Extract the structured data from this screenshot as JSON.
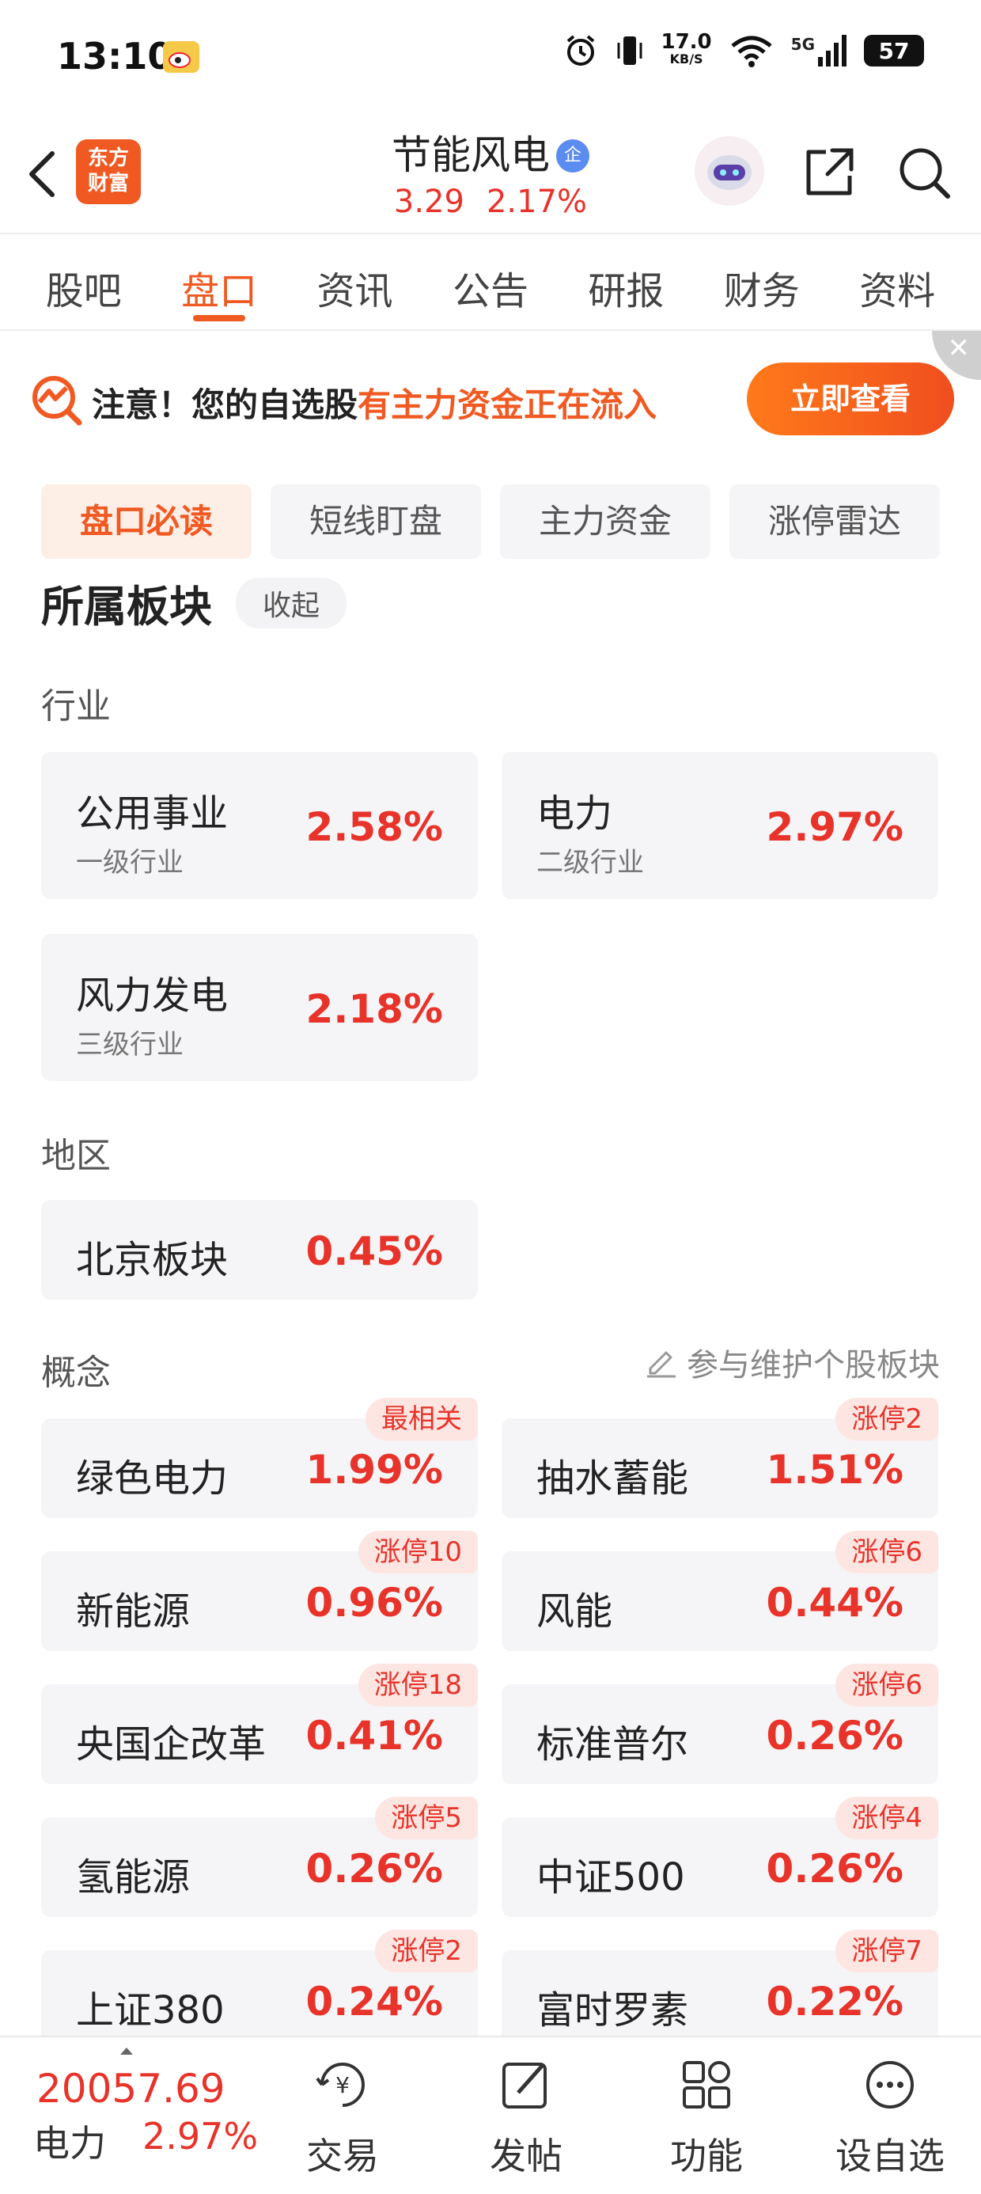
{
  "status_bar": {
    "time": "13:10",
    "net_speed_value": "17.0",
    "net_speed_unit": "KB/S",
    "network": "5G",
    "battery": "57"
  },
  "header": {
    "logo_line1": "东方",
    "logo_line2": "财富",
    "title": "节能风电",
    "title_badge": "企",
    "price": "3.29",
    "change_pct": "2.17%"
  },
  "main_tabs": [
    {
      "label": "股吧",
      "active": false
    },
    {
      "label": "盘口",
      "active": true
    },
    {
      "label": "资讯",
      "active": false
    },
    {
      "label": "公告",
      "active": false
    },
    {
      "label": "研报",
      "active": false
    },
    {
      "label": "财务",
      "active": false
    },
    {
      "label": "资料",
      "active": false
    }
  ],
  "alert": {
    "prefix": "注意！您的自选股",
    "highlight": "有主力资金正在流入",
    "button": "立即查看",
    "close": "✕"
  },
  "sub_tabs": [
    {
      "label": "盘口必读",
      "active": true
    },
    {
      "label": "短线盯盘",
      "active": false
    },
    {
      "label": "主力资金",
      "active": false
    },
    {
      "label": "涨停雷达",
      "active": false
    }
  ],
  "section": {
    "title": "所属板块",
    "collapse": "收起"
  },
  "industry": {
    "label": "行业",
    "items": [
      {
        "name": "公用事业",
        "sub": "一级行业",
        "pct": "2.58%"
      },
      {
        "name": "电力",
        "sub": "二级行业",
        "pct": "2.97%"
      },
      {
        "name": "风力发电",
        "sub": "三级行业",
        "pct": "2.18%"
      }
    ]
  },
  "region": {
    "label": "地区",
    "items": [
      {
        "name": "北京板块",
        "pct": "0.45%"
      }
    ]
  },
  "concept": {
    "label": "概念",
    "maintain_link": "参与维护个股板块",
    "items": [
      {
        "name": "绿色电力",
        "pct": "1.99%",
        "tag": "最相关"
      },
      {
        "name": "抽水蓄能",
        "pct": "1.51%",
        "tag": "涨停2"
      },
      {
        "name": "新能源",
        "pct": "0.96%",
        "tag": "涨停10"
      },
      {
        "name": "风能",
        "pct": "0.44%",
        "tag": "涨停6"
      },
      {
        "name": "央国企改革",
        "pct": "0.41%",
        "tag": "涨停18"
      },
      {
        "name": "标准普尔",
        "pct": "0.26%",
        "tag": "涨停6"
      },
      {
        "name": "氢能源",
        "pct": "0.26%",
        "tag": "涨停5"
      },
      {
        "name": "中证500",
        "pct": "0.26%",
        "tag": "涨停4"
      },
      {
        "name": "上证380",
        "pct": "0.24%",
        "tag": "涨停2"
      },
      {
        "name": "富时罗素",
        "pct": "0.22%",
        "tag": "涨停7"
      }
    ]
  },
  "bottom_bar": {
    "price": "20057.69",
    "sector_name": "电力",
    "sector_change": "2.97%",
    "actions": [
      {
        "label": "交易",
        "icon": "trade-icon"
      },
      {
        "label": "发帖",
        "icon": "post-icon"
      },
      {
        "label": "功能",
        "icon": "grid-icon"
      },
      {
        "label": "设自选",
        "icon": "more-icon"
      }
    ]
  },
  "colors": {
    "accent": "#f05a22",
    "up": "#e8332a",
    "card_bg": "#f5f5f7"
  }
}
